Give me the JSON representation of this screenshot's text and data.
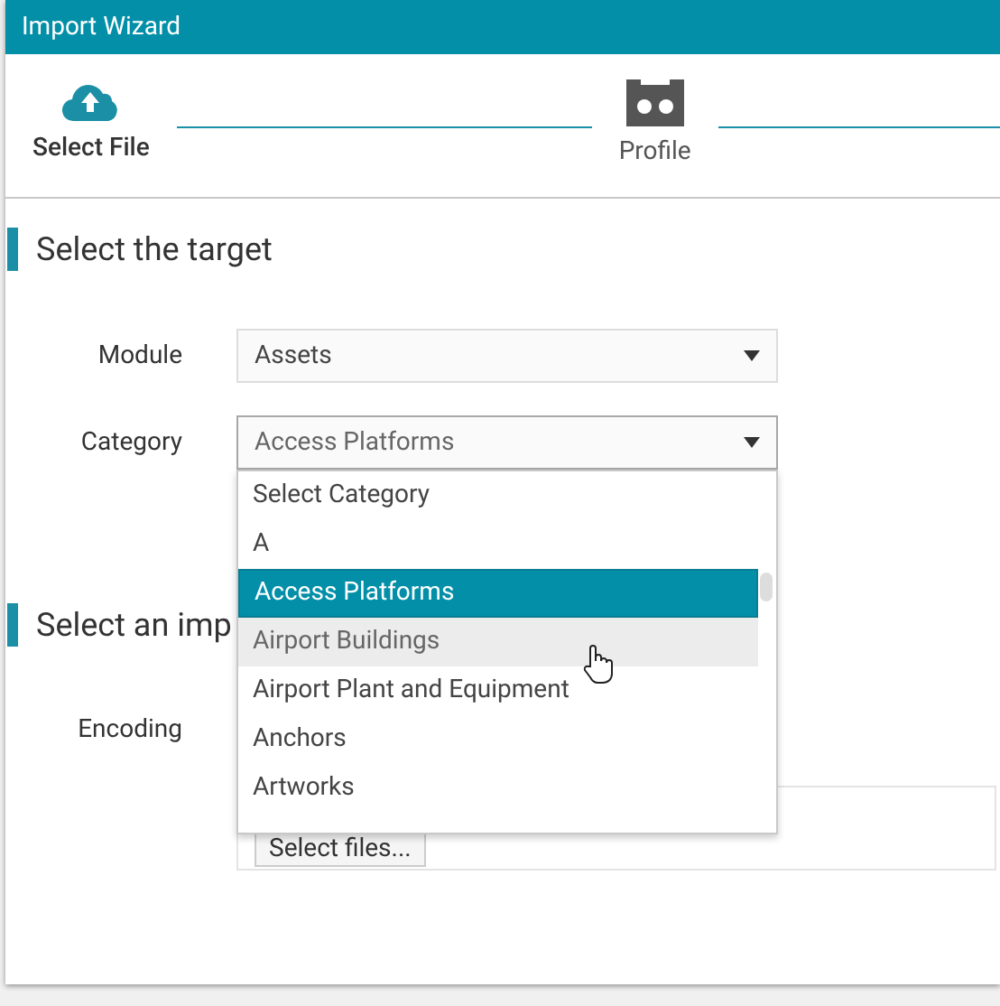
{
  "window": {
    "title": "Import Wizard"
  },
  "steps": [
    {
      "label": "Select File",
      "kind": "upload",
      "selected": true
    },
    {
      "label": "Profile",
      "kind": "profile",
      "selected": false
    }
  ],
  "target_section": {
    "heading": "Select the target",
    "fields": [
      {
        "label": "Module",
        "value": "Assets",
        "open": false
      },
      {
        "label": "Category",
        "value": "Access Platforms",
        "open": true
      }
    ]
  },
  "category_options": [
    {
      "label": "Select Category",
      "selected": false,
      "hovered": false
    },
    {
      "label": "A",
      "selected": false,
      "hovered": false
    },
    {
      "label": "Access Platforms",
      "selected": true,
      "hovered": false
    },
    {
      "label": "Airport Buildings",
      "selected": false,
      "hovered": true
    },
    {
      "label": "Airport Plant and Equipment",
      "selected": false,
      "hovered": false
    },
    {
      "label": "Anchors",
      "selected": false,
      "hovered": false
    },
    {
      "label": "Artworks",
      "selected": false,
      "hovered": false
    }
  ],
  "import_section": {
    "heading": "Select an imp",
    "encoding_label": "Encoding",
    "upload_button": "Select files..."
  }
}
